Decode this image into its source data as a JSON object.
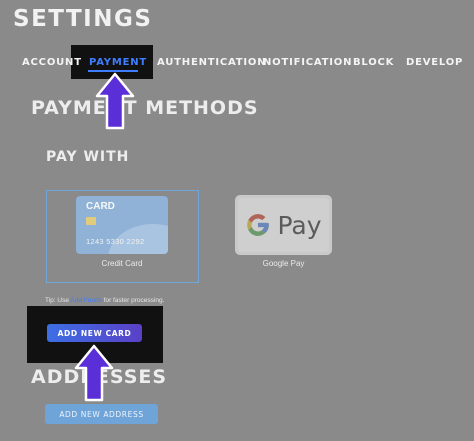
{
  "header": {
    "title": "SETTINGS"
  },
  "tabs": [
    {
      "label": "ACCOUNT"
    },
    {
      "label": "PAYMENT",
      "active": true
    },
    {
      "label": "AUTHENTICATION"
    },
    {
      "label": "NOTIFICATION"
    },
    {
      "label": "BLOCK"
    },
    {
      "label": "DEVELOP"
    }
  ],
  "payment_methods": {
    "title": "PAYMENT METHODS",
    "pay_with": "PAY WITH",
    "options": [
      {
        "name": "Credit Card",
        "card_label": "CARD",
        "card_number": "1243 5330 2292",
        "selected": true
      },
      {
        "name": "Google Pay",
        "logo_text": "Pay"
      }
    ],
    "tip": {
      "prefix": "Tip: Use ",
      "link": "Add Funds",
      "suffix": " for faster processing."
    },
    "add_card_label": "ADD NEW CARD"
  },
  "addresses": {
    "title": "ADDRESSES",
    "add_address_label": "ADD NEW ADDRESS"
  },
  "colors": {
    "background": "#8a8a8a",
    "accent": "#3f7dff",
    "highlight_box": "#111111",
    "arrow": "#5b2fd8"
  }
}
